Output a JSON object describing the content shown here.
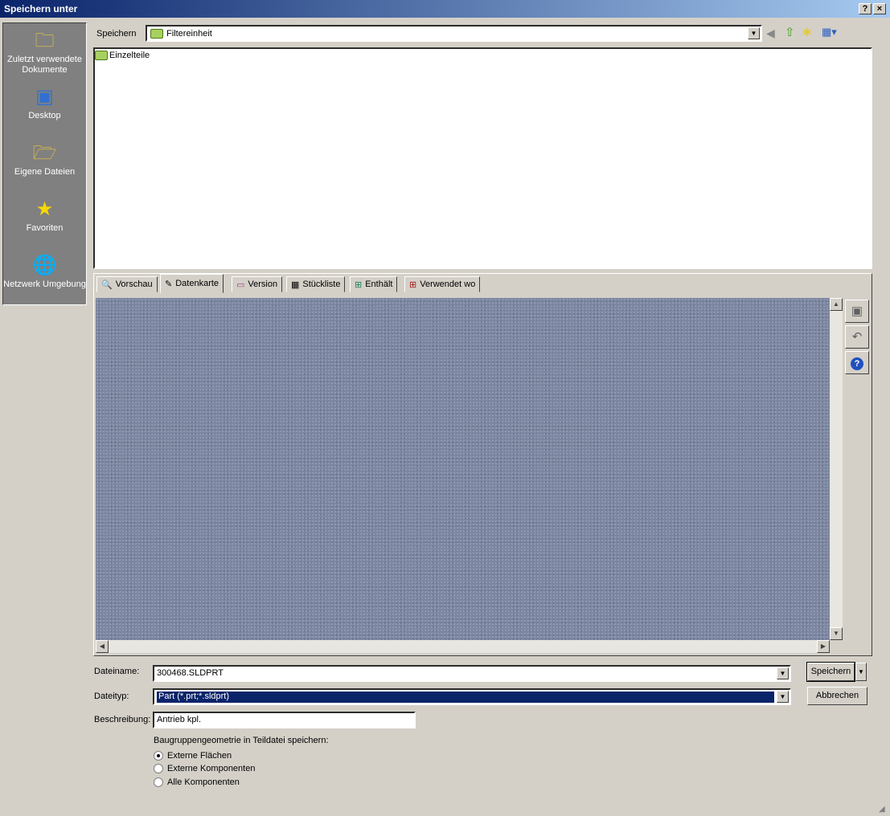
{
  "window": {
    "title": "Speichern unter",
    "help": "?",
    "close": "×"
  },
  "sidebar": {
    "items": [
      {
        "label": "Zuletzt verwendete Dokumente",
        "icon": "recent-documents-icon"
      },
      {
        "label": "Desktop",
        "icon": "desktop-icon"
      },
      {
        "label": "Eigene Dateien",
        "icon": "my-documents-icon"
      },
      {
        "label": "Favoriten",
        "icon": "favorites-icon"
      },
      {
        "label": "Netzwerk Umgebung",
        "icon": "network-icon"
      }
    ]
  },
  "location": {
    "label": "Speichern",
    "value": "Filtereinheit"
  },
  "files": [
    {
      "name": "Einzelteile",
      "type": "folder"
    }
  ],
  "tabs": [
    {
      "label": "Vorschau"
    },
    {
      "label": "Datenkarte",
      "active": true
    },
    {
      "label": "Version"
    },
    {
      "label": "Stückliste"
    },
    {
      "label": "Enthält"
    },
    {
      "label": "Verwendet wo"
    }
  ],
  "form": {
    "filename_label": "Dateiname:",
    "filename": "300468.SLDPRT",
    "filetype_label": "Dateityp:",
    "filetype": "Part (*.prt;*.sldprt)",
    "description_label": "Beschreibung:",
    "description": "Antrieb kpl.",
    "group_label": "Baugruppengeometrie in Teildatei speichern:",
    "options": [
      {
        "label": "Externe Flächen",
        "checked": true
      },
      {
        "label": "Externe Komponenten",
        "checked": false
      },
      {
        "label": "Alle Komponenten",
        "checked": false
      }
    ]
  },
  "buttons": {
    "save": "Speichern",
    "cancel": "Abbrechen"
  }
}
